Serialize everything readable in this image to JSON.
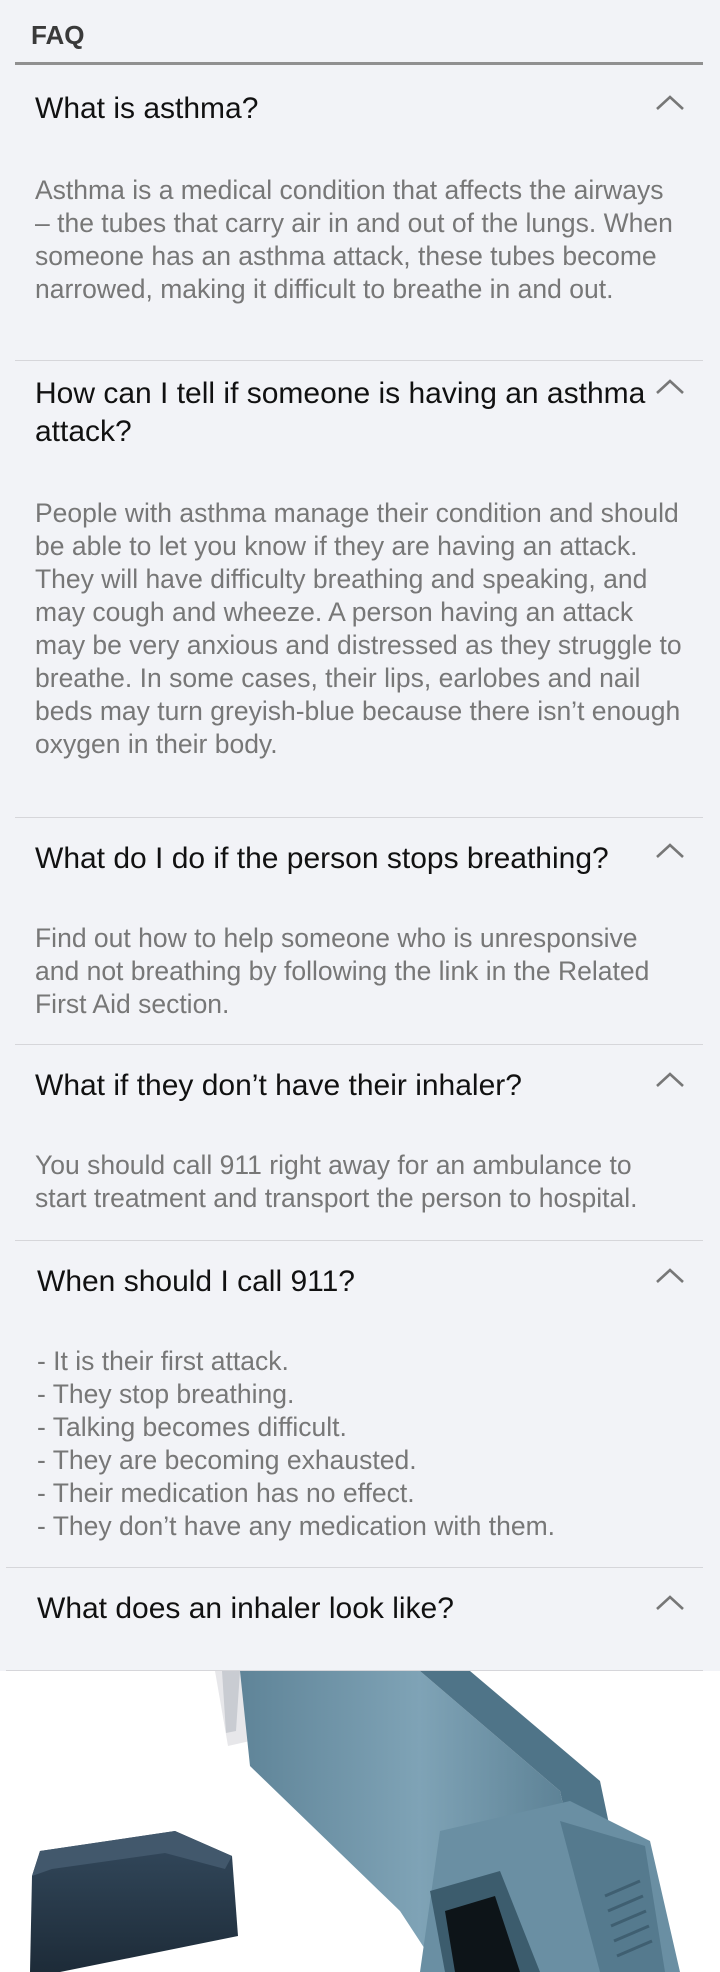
{
  "header": {
    "title": "FAQ"
  },
  "faq": [
    {
      "question": "What is asthma?",
      "answer": "Asthma is a medical condition that affects the airways – the tubes that carry air in and out of the lungs. When someone has an asthma attack, these tubes become narrowed, making it difficult to breathe in and out."
    },
    {
      "question": "How can I tell if someone is having an asthma attack?",
      "answer": "People with asthma manage their condition and should be able to let you know if they are having an attack. They will have difficulty breathing and speaking, and may cough and wheeze. A person having an attack may be very anxious and distressed as they struggle to breathe. In some cases, their lips, earlobes and nail beds may turn greyish-blue because there isn’t enough oxygen in their body."
    },
    {
      "question": "What do I do if the person stops breathing?",
      "answer": "Find out how to help someone who is unresponsive and not breathing by following the link in the Related First Aid section."
    },
    {
      "question": "What if they don’t have their inhaler?",
      "answer": "You should call 911 right away for an ambulance to start treatment and transport the person to hospital."
    },
    {
      "question": "When should I call 911?",
      "answer_lines": [
        "- It is their first attack.",
        "- They stop breathing.",
        "- Talking becomes difficult.",
        "- They are becoming exhausted.",
        "- Their medication has no effect.",
        "- They don’t have any medication with them."
      ]
    },
    {
      "question": "What does an inhaler look like?"
    }
  ],
  "icons": {
    "chevron": "chevron-up-icon"
  },
  "colors": {
    "background": "#f2f3f7",
    "question_text": "#111111",
    "answer_text": "#777777",
    "inhaler_body": "#6f94a8",
    "inhaler_cap": "#2b3c4e"
  }
}
